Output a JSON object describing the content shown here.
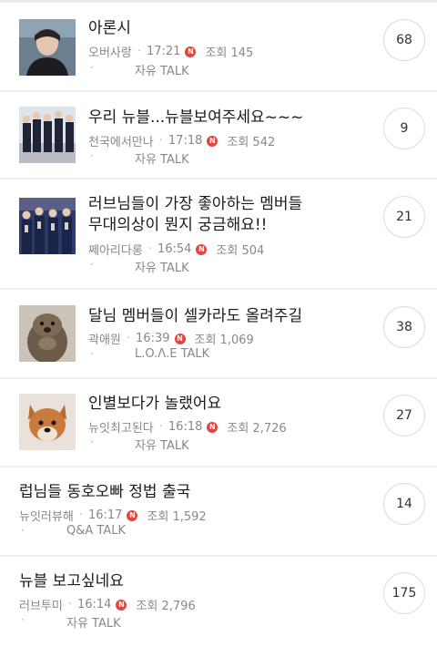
{
  "posts": [
    {
      "title_lines": [
        "아론시"
      ],
      "author": "오버사랑",
      "time": "17:21",
      "new_badge": "N",
      "views_label": "조회 145",
      "board": "자유 TALK",
      "comments": "68",
      "bullet": "·"
    },
    {
      "title_lines": [
        "우리 뉴블...뉴블보여주세요~~~"
      ],
      "author": "천국에서만나",
      "time": "17:18",
      "new_badge": "N",
      "views_label": "조회 542",
      "board": "자유 TALK",
      "comments": "9",
      "bullet": "·"
    },
    {
      "title_lines": [
        "러브님들이 가장 좋아하는 멤버들",
        "무대의상이 뭔지 궁금해요!!"
      ],
      "author": "쩨아리다롱",
      "time": "16:54",
      "new_badge": "N",
      "views_label": "조회 504",
      "board": "자유 TALK",
      "comments": "21",
      "bullet": "·"
    },
    {
      "title_lines": [
        "달님 멤버들이 셀카라도 올려주길"
      ],
      "author": "곽애뭔",
      "time": "16:39",
      "new_badge": "N",
      "views_label": "조회 1,069",
      "board": "L.O.Λ.E TALK",
      "comments": "38",
      "bullet": "·"
    },
    {
      "title_lines": [
        "인별보다가 놀랬어요"
      ],
      "author": "뉴잇최고된다",
      "time": "16:18",
      "new_badge": "N",
      "views_label": "조회 2,726",
      "board": "자유 TALK",
      "comments": "27",
      "bullet": "·"
    },
    {
      "title_lines": [
        "럽님들 동호오빠 정법 출국"
      ],
      "author": "뉴잇러뷰해",
      "time": "16:17",
      "new_badge": "N",
      "views_label": "조회 1,592",
      "board": "Q&A TALK",
      "comments": "14",
      "bullet": "·"
    },
    {
      "title_lines": [
        "뉴블 보고싶네요"
      ],
      "author": "러브투미",
      "time": "16:14",
      "new_badge": "N",
      "views_label": "조회 2,796",
      "board": "자유 TALK",
      "comments": "175",
      "bullet": "·"
    }
  ]
}
